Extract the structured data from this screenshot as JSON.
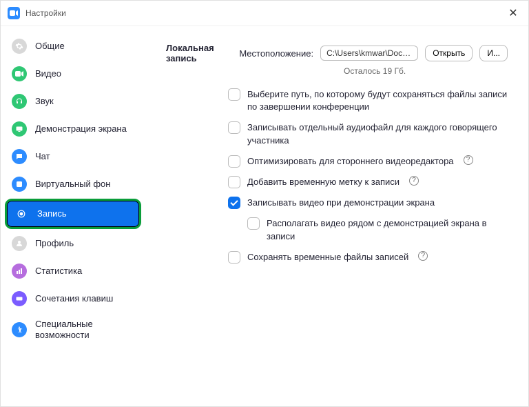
{
  "window": {
    "title": "Настройки"
  },
  "sidebar": {
    "items": [
      {
        "label": "Общие",
        "icon": "gear-icon",
        "color": "#d8d8d8"
      },
      {
        "label": "Видео",
        "icon": "video-icon",
        "color": "#2fc774"
      },
      {
        "label": "Звук",
        "icon": "headphones-icon",
        "color": "#2fc774"
      },
      {
        "label": "Демонстрация экрана",
        "icon": "share-screen-icon",
        "color": "#2fc774"
      },
      {
        "label": "Чат",
        "icon": "chat-icon",
        "color": "#2D8CFF"
      },
      {
        "label": "Виртуальный фон",
        "icon": "background-icon",
        "color": "#2D8CFF"
      },
      {
        "label": "Запись",
        "icon": "record-icon",
        "color": "#ffffff",
        "selected": true
      },
      {
        "label": "Профиль",
        "icon": "profile-icon",
        "color": "#d8d8d8"
      },
      {
        "label": "Статистика",
        "icon": "stats-icon",
        "color": "#b66dde"
      },
      {
        "label": "Сочетания клавиш",
        "icon": "keyboard-icon",
        "color": "#7b5cff"
      },
      {
        "label": "Специальные возможности",
        "icon": "accessibility-icon",
        "color": "#2D8CFF"
      }
    ]
  },
  "main": {
    "section_title": "Локальная запись",
    "location_label": "Местоположение:",
    "location_value": "C:\\Users\\kmwar\\Documents\\Zo",
    "open_button": "Открыть",
    "change_button": "И...",
    "remaining": "Осталось 19 Гб.",
    "options": [
      {
        "label": "Выберите путь, по которому будут сохраняться файлы записи по завершении конференции",
        "checked": false
      },
      {
        "label": "Записывать отдельный аудиофайл для каждого говорящего участника",
        "checked": false
      },
      {
        "label": "Оптимизировать для стороннего видеоредактора",
        "checked": false,
        "help": true
      },
      {
        "label": "Добавить временную метку к записи",
        "checked": false,
        "help": true
      },
      {
        "label": "Записывать видео при демонстрации экрана",
        "checked": true
      },
      {
        "label": "Располагать видео рядом с демонстрацией экрана в записи",
        "checked": false,
        "sub": true
      },
      {
        "label": "Сохранять временные файлы записей",
        "checked": false,
        "help": true
      }
    ]
  }
}
